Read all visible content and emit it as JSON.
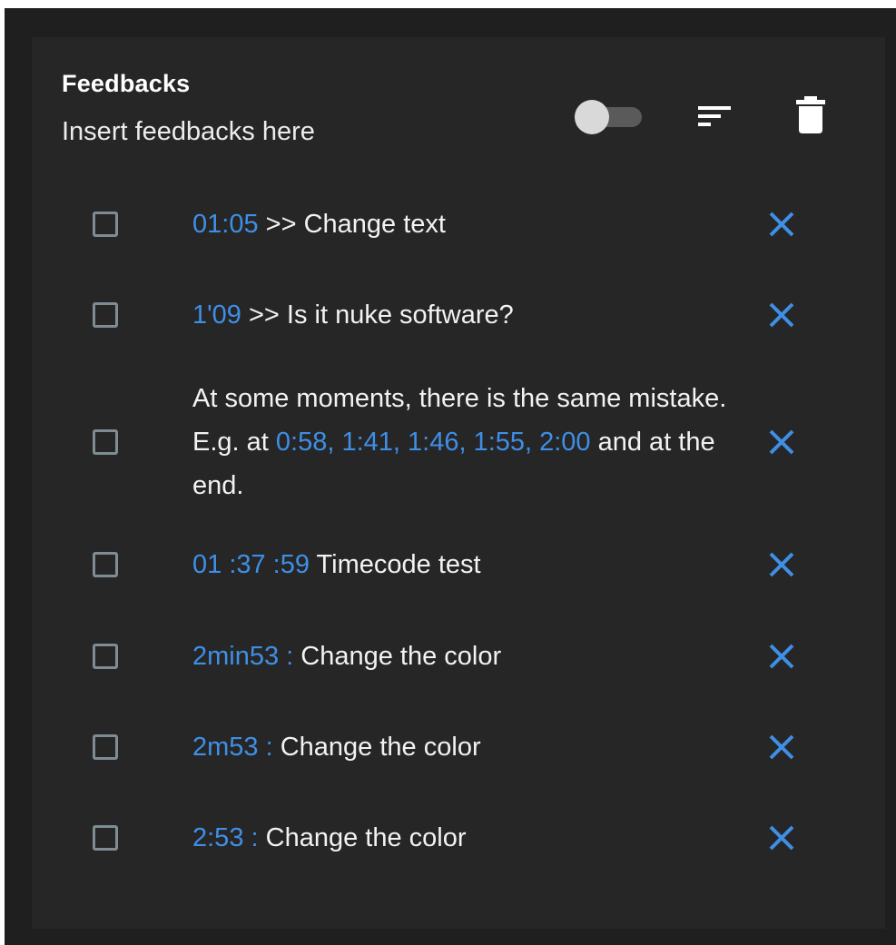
{
  "panel": {
    "title": "Feedbacks",
    "subtitle": "Insert feedbacks here",
    "toggle_on": false,
    "icons": [
      "toggle-switch",
      "sort-icon",
      "trash-icon"
    ]
  },
  "items": [
    {
      "checked": false,
      "timecode": "01:05",
      "text": " >> Change text"
    },
    {
      "checked": false,
      "timecode": "1'09",
      "text": " >> Is it nuke software?"
    },
    {
      "checked": false,
      "pre": "At some moments, there is the same mistake. E.g. at ",
      "timecode": "0:58, 1:41, 1:46, 1:55, 2:00",
      "text": " and at the end."
    },
    {
      "checked": false,
      "timecode": "01 :37 :59",
      "text": " Timecode test"
    },
    {
      "checked": false,
      "timecode": "2min53 :",
      "text": " Change the color"
    },
    {
      "checked": false,
      "timecode": "2m53 :",
      "text": " Change the color"
    },
    {
      "checked": false,
      "timecode": "2:53 :",
      "text": " Change the color"
    }
  ],
  "colors": {
    "background": "#1f1f1f",
    "panel": "#262626",
    "timecode": "#3f8fe6",
    "close_icon": "#3f8fe6",
    "checkbox_border": "#7f8c93",
    "text": "#f2f2f2"
  }
}
